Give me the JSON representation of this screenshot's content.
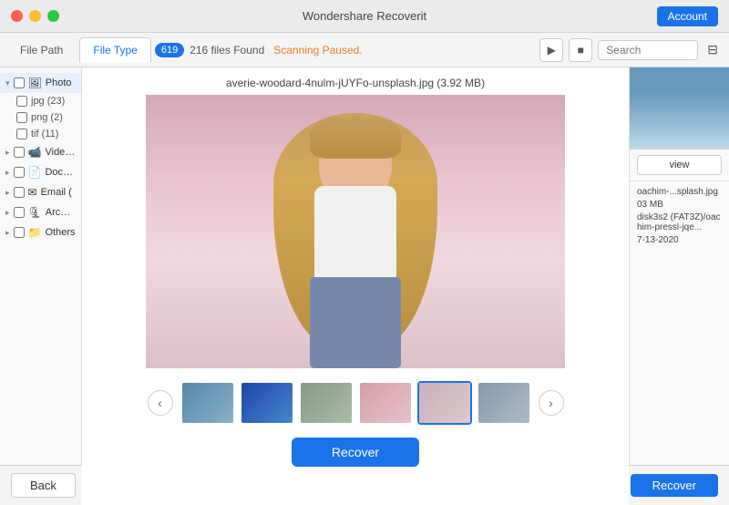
{
  "titleBar": {
    "appName": "Wondershare Recoverit",
    "accountLabel": "Account"
  },
  "toolbar": {
    "filePath": "File Path",
    "fileType": "File Type",
    "scanBadge": "619",
    "filesFound": "216 files Found",
    "scanStatus": "Scanning Paused.",
    "searchPlaceholder": "Search"
  },
  "sidebar": {
    "categories": [
      {
        "id": "photos",
        "label": "Photo",
        "expanded": true,
        "active": true
      },
      {
        "id": "jpg",
        "label": "jpg (23)",
        "sub": true
      },
      {
        "id": "png",
        "label": "png (2)",
        "sub": true
      },
      {
        "id": "tif",
        "label": "tif (11)",
        "sub": true
      },
      {
        "id": "video",
        "label": "Video (",
        "expanded": false
      },
      {
        "id": "documents",
        "label": "Docum (",
        "expanded": false
      },
      {
        "id": "email",
        "label": "Email (",
        "expanded": false
      },
      {
        "id": "archive",
        "label": "Archiv (",
        "expanded": false
      },
      {
        "id": "others",
        "label": "Others",
        "expanded": false
      }
    ]
  },
  "preview": {
    "filename": "averie-woodard-4nulm-jUYFo-unsplash.jpg (3.92 MB)",
    "thumbnails": [
      {
        "id": 1,
        "label": "landscape-1",
        "selected": false
      },
      {
        "id": 2,
        "label": "landscape-2",
        "selected": false
      },
      {
        "id": 3,
        "label": "cityscape",
        "selected": false
      },
      {
        "id": 4,
        "label": "portrait-face",
        "selected": false
      },
      {
        "id": 5,
        "label": "portrait-woman",
        "selected": true
      },
      {
        "id": 6,
        "label": "drone-shot",
        "selected": false
      }
    ],
    "recoverLabel": "Recover"
  },
  "rightPanel": {
    "previewLabel": "view",
    "filename": "oachim-...splash.jpg",
    "filesize": "03 MB",
    "location": "disk3s2 (FAT3Z)/oachim-pressl-jqe...",
    "date": "7-13-2020"
  },
  "bottomBar": {
    "backLabel": "Back",
    "recoverLabel": "Recover"
  },
  "viewIcons": {
    "grid": "▦",
    "list": "☰"
  }
}
